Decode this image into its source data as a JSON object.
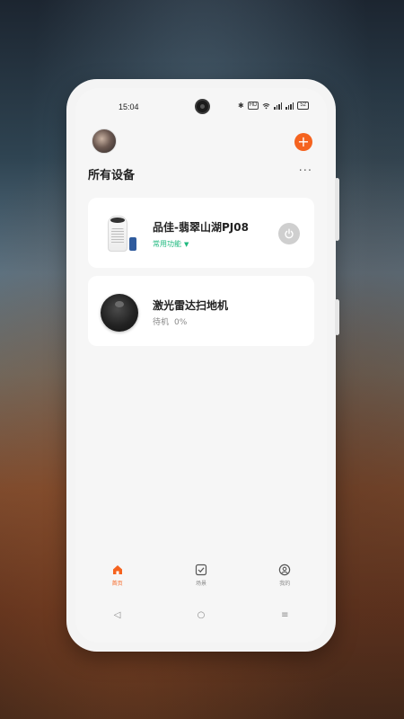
{
  "statusbar": {
    "time": "15:04",
    "bluetooth": "✱",
    "hd": "HD",
    "battery": "52"
  },
  "header": {
    "add_label": "+",
    "page_title": "所有设备",
    "more_label": "···"
  },
  "devices": [
    {
      "name": "品佳-翡翠山湖PJ08",
      "quick_function": "常用功能",
      "icon": "air-purifier-icon"
    },
    {
      "name": "激光雷达扫地机",
      "status": "待机",
      "battery": "0%",
      "icon": "robot-vacuum-icon"
    }
  ],
  "bottom_nav": [
    {
      "label": "首页",
      "icon": "home-icon",
      "active": true
    },
    {
      "label": "场景",
      "icon": "scene-icon",
      "active": false
    },
    {
      "label": "我的",
      "icon": "profile-icon",
      "active": false
    }
  ],
  "system_nav": {
    "back": "◁",
    "home": "○",
    "menu": "≡"
  },
  "colors": {
    "accent": "#f5631f",
    "quick_function": "#20b97f"
  }
}
